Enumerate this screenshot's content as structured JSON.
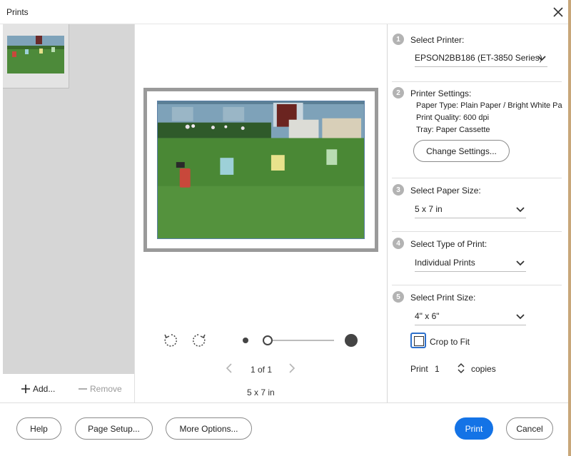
{
  "window": {
    "title": "Prints"
  },
  "left_panel": {
    "add_label": "Add...",
    "remove_label": "Remove"
  },
  "preview": {
    "page_indicator": "1 of 1",
    "size_label": "5 x 7 in",
    "zoom_level": 0
  },
  "steps": [
    {
      "number": "1",
      "label": "Select Printer:"
    },
    {
      "number": "2",
      "label": "Printer Settings:"
    },
    {
      "number": "3",
      "label": "Select Paper Size:"
    },
    {
      "number": "4",
      "label": "Select Type of Print:"
    },
    {
      "number": "5",
      "label": "Select Print Size:"
    }
  ],
  "printer": {
    "selected": "EPSON2BB186 (ET-3850 Series)"
  },
  "printer_settings": {
    "paper_type": "Paper Type: Plain Paper / Bright White Pa",
    "print_quality": "Print Quality: 600 dpi",
    "tray": "Tray: Paper Cassette",
    "change_button": "Change Settings..."
  },
  "paper_size": {
    "selected": "5 x 7 in"
  },
  "print_type": {
    "selected": "Individual Prints"
  },
  "print_size": {
    "selected": "4\" x 6\""
  },
  "crop": {
    "label": "Crop to Fit",
    "checked": false
  },
  "copies": {
    "label": "Print",
    "value": "1",
    "unit": "copies"
  },
  "footer": {
    "help": "Help",
    "page_setup": "Page Setup...",
    "more_options": "More Options...",
    "print": "Print",
    "cancel": "Cancel"
  },
  "colors": {
    "accent": "#1473e6",
    "checkbox_focus": "#2c6fcb"
  },
  "icons": [
    "close-icon",
    "plus-icon",
    "minus-icon",
    "rotate-left-icon",
    "rotate-right-icon",
    "chevron-down-icon",
    "chevron-left-icon",
    "chevron-right-icon",
    "spinner-icon"
  ]
}
